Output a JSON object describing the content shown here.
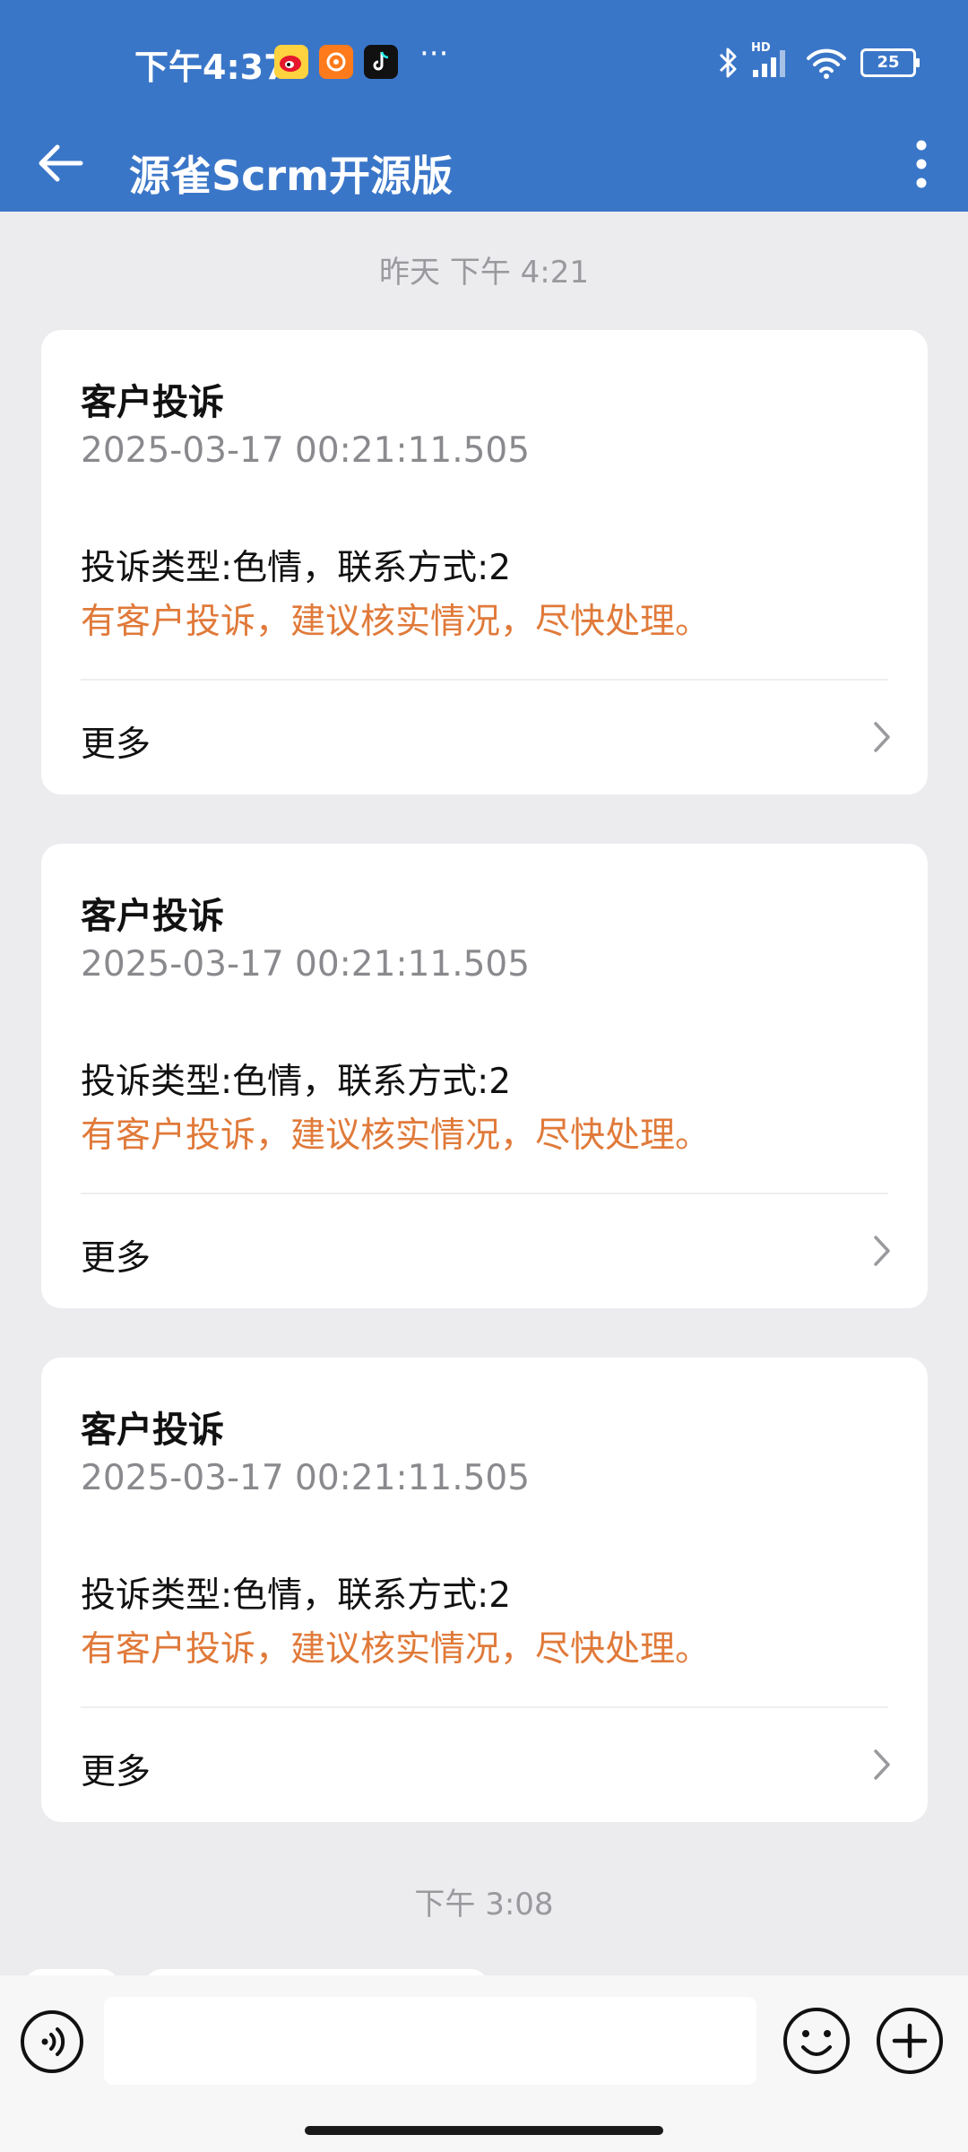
{
  "status_bar": {
    "time": "下午4:37",
    "dots": "···",
    "battery": "25",
    "network_label": "HD"
  },
  "header": {
    "title": "源雀Scrm开源版"
  },
  "timeline": {
    "label_1": "昨天  下午 4:21",
    "label_2": "下午 3:08"
  },
  "cards": [
    {
      "title": "客户投诉",
      "date": "2025-03-17 00:21:11.505",
      "line1": "投诉类型:色情，联系方式:2",
      "line2": "有客户投诉，建议核实情况，尽快处理。",
      "more": "更多"
    },
    {
      "title": "客户投诉",
      "date": "2025-03-17 00:21:11.505",
      "line1": "投诉类型:色情，联系方式:2",
      "line2": "有客户投诉，建议核实情况，尽快处理。",
      "more": "更多"
    },
    {
      "title": "客户投诉",
      "date": "2025-03-17 00:21:11.505",
      "line1": "投诉类型:色情，联系方式:2",
      "line2": "有客户投诉，建议核实情况，尽快处理。",
      "more": "更多"
    }
  ],
  "input": {
    "value": "",
    "placeholder": ""
  },
  "colors": {
    "header": "#3a76c8",
    "accent_text": "#e07a3a",
    "background": "#ececef"
  }
}
